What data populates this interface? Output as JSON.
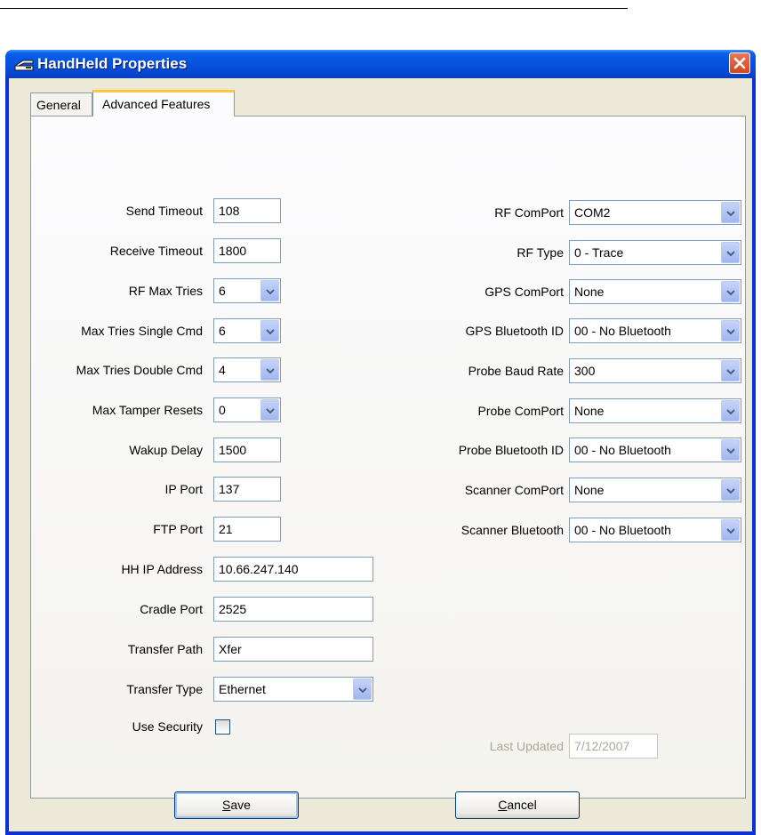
{
  "window": {
    "title": "HandHeld Properties"
  },
  "tabs": [
    {
      "label": "General"
    },
    {
      "label": "Advanced Features"
    }
  ],
  "left_fields": [
    {
      "label": "Send Timeout",
      "value": "108",
      "kind": "text"
    },
    {
      "label": "Receive Timeout",
      "value": "1800",
      "kind": "text"
    },
    {
      "label": "RF Max Tries",
      "value": "6",
      "kind": "combo"
    },
    {
      "label": "Max Tries Single Cmd",
      "value": "6",
      "kind": "combo"
    },
    {
      "label": "Max Tries Double Cmd",
      "value": "4",
      "kind": "combo"
    },
    {
      "label": "Max Tamper Resets",
      "value": "0",
      "kind": "combo"
    },
    {
      "label": "Wakup Delay",
      "value": "1500",
      "kind": "text"
    },
    {
      "label": "IP Port",
      "value": "137",
      "kind": "text"
    },
    {
      "label": "FTP Port",
      "value": "21",
      "kind": "text"
    },
    {
      "label": "HH IP Address",
      "value": "10.66.247.140",
      "kind": "text"
    },
    {
      "label": "Cradle Port",
      "value": "2525",
      "kind": "text"
    },
    {
      "label": "Transfer Path",
      "value": "Xfer",
      "kind": "text"
    },
    {
      "label": "Transfer Type",
      "value": "Ethernet",
      "kind": "combo"
    },
    {
      "label": "Use Security",
      "value": "",
      "kind": "checkbox"
    }
  ],
  "right_fields": [
    {
      "label": "RF ComPort",
      "value": "COM2"
    },
    {
      "label": "RF Type",
      "value": "0 - Trace"
    },
    {
      "label": "GPS ComPort",
      "value": "None"
    },
    {
      "label": "GPS Bluetooth ID",
      "value": "00 - No Bluetooth"
    },
    {
      "label": "Probe Baud Rate",
      "value": "300"
    },
    {
      "label": "Probe ComPort",
      "value": "None"
    },
    {
      "label": "Probe Bluetooth ID",
      "value": "00 - No Bluetooth"
    },
    {
      "label": "Scanner ComPort",
      "value": "None"
    },
    {
      "label": "Scanner Bluetooth",
      "value": "00 - No Bluetooth"
    }
  ],
  "last_updated": {
    "label": "Last Updated",
    "value": "7/12/2007"
  },
  "use_security_checked": false,
  "buttons": {
    "save": "Save",
    "cancel": "Cancel"
  },
  "icons": {
    "title": "handheld-icon",
    "close": "close-icon",
    "dropdown": "chevron-down-icon"
  },
  "colors": {
    "titlebar": "#0553e0",
    "face": "#ece9d8",
    "tab_highlight": "#ffc83c",
    "close": "#d5441f"
  }
}
